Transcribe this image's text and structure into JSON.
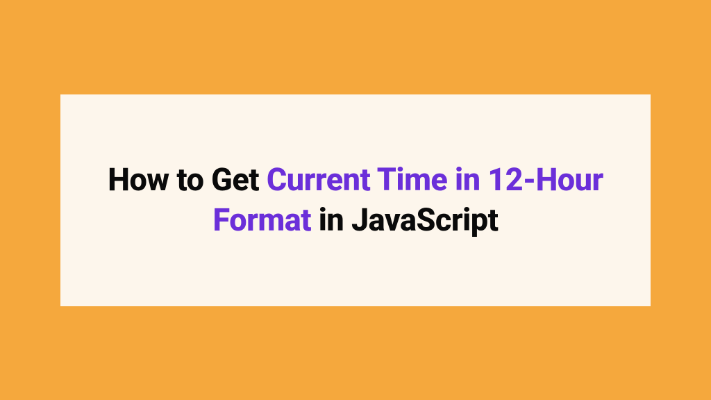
{
  "title": {
    "part1": "How to Get ",
    "highlight": "Current Time in 12-Hour Format",
    "part2": " in JavaScript"
  },
  "colors": {
    "background": "#F5A83D",
    "card": "#FDF6EC",
    "text": "#0A0A0A",
    "highlight": "#6B2FD9"
  }
}
